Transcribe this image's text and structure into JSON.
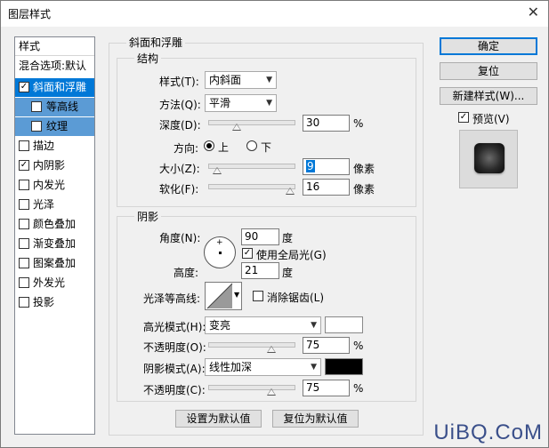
{
  "window": {
    "title": "图层样式",
    "close_glyph": "✕"
  },
  "sidebar": {
    "items": [
      {
        "label": "样式",
        "checkbox": null
      },
      {
        "label": "混合选项:默认",
        "checkbox": null
      },
      {
        "label": "斜面和浮雕",
        "checkbox": true,
        "state": "selected"
      },
      {
        "label": "等高线",
        "checkbox": false,
        "state": "sub"
      },
      {
        "label": "纹理",
        "checkbox": false,
        "state": "sub"
      },
      {
        "label": "描边",
        "checkbox": false
      },
      {
        "label": "内阴影",
        "checkbox": true
      },
      {
        "label": "内发光",
        "checkbox": false
      },
      {
        "label": "光泽",
        "checkbox": false
      },
      {
        "label": "颜色叠加",
        "checkbox": false
      },
      {
        "label": "渐变叠加",
        "checkbox": false
      },
      {
        "label": "图案叠加",
        "checkbox": false
      },
      {
        "label": "外发光",
        "checkbox": false
      },
      {
        "label": "投影",
        "checkbox": false
      }
    ]
  },
  "bevel": {
    "group_title": "斜面和浮雕",
    "structure_title": "结构",
    "style_label": "样式(T):",
    "style_value": "内斜面",
    "technique_label": "方法(Q):",
    "technique_value": "平滑",
    "depth_label": "深度(D):",
    "depth_value": "30",
    "depth_unit": "%",
    "depth_level": 0.3,
    "direction_label": "方向:",
    "dir_up": "上",
    "dir_down": "下",
    "size_label": "大小(Z):",
    "size_value": "9",
    "size_unit": "像素",
    "size_level": 0.05,
    "soften_label": "软化(F):",
    "soften_value": "16",
    "soften_unit": "像素",
    "soften_level": 1.0
  },
  "shading": {
    "title": "阴影",
    "angle_label": "角度(N):",
    "angle_value": "90",
    "angle_unit": "度",
    "global_light_label": "使用全局光(G)",
    "altitude_label": "高度:",
    "altitude_value": "21",
    "altitude_unit": "度",
    "gloss_label": "光泽等高线:",
    "antialias_label": "消除锯齿(L)",
    "highlight_label": "高光模式(H):",
    "highlight_value": "变亮",
    "highlight_color": "#ffffff",
    "hl_opacity_label": "不透明度(O):",
    "hl_opacity_value": "75",
    "hl_opacity_unit": "%",
    "hl_opacity_level": 0.75,
    "shadow_label": "阴影模式(A):",
    "shadow_value": "线性加深",
    "shadow_color": "#000000",
    "sh_opacity_label": "不透明度(C):",
    "sh_opacity_value": "75",
    "sh_opacity_unit": "%",
    "sh_opacity_level": 0.75
  },
  "footer": {
    "make_default": "设置为默认值",
    "reset_default": "复位为默认值"
  },
  "right": {
    "ok": "确定",
    "reset": "复位",
    "new_style": "新建样式(W)...",
    "preview_label": "预览(V)"
  },
  "watermark": "UiBQ.CoM"
}
